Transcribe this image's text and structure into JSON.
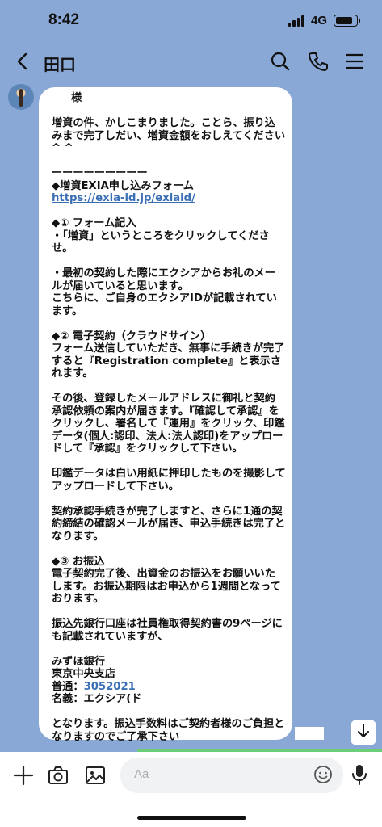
{
  "status": {
    "time": "8:42",
    "network": "4G"
  },
  "header": {
    "title": "田口"
  },
  "message": {
    "greeting": "様",
    "body_top": "増資の件、かしこまりました。ことら、振り込みまで完了しだい、増資金額をおしえてください^ ^\n\nーーーーーーーーー\n◆増資EXIA申し込みフォーム\n",
    "link": "https://exia-id.jp/exiaid/",
    "body_mid": "\n\n◆① フォーム記入\n・「増資」というところをクリックしてくださせ。\n\n・最初の契約した際にエクシアからお礼のメールが届いていると思います。\nこちらに、ご自身のエクシアIDが記載されています。\n\n◆② 電子契約（クラウドサイン）\nフォーム送信していただき、無事に手続きが完了すると『Registration complete』と表示されます。\n\nその後、登録したメールアドレスに御礼と契約承認依頼の案内が届きます。『確認して承認』をクリックし、署名して『運用』をクリック、印鑑データ(個人:認印、法人:法人認印)をアップロードして『承認』をクリックして下さい。\n\n印鑑データは白い用紙に押印したものを撮影してアップロードして下さい。\n\n契約承認手続きが完了しますと、さらに1通の契約締結の確認メールが届き、申込手続きは完了となります。\n\n◆③ お振込\n電子契約完了後、出資金のお振込をお願いいたします。お振込期限はお申込から1週間となっております。\n\n振込先銀行口座は社員権取得契約書の9ページにも記載されていますが、\n\nみずほ銀行\n東京中央支店\n普通：",
    "account_number": "3052021",
    "body_end": "\n名義：エクシア(ド\n\nとなります。振込手数料はご契約者様のご負担となりますのでご了承下さい"
  },
  "input": {
    "placeholder": "Aa"
  },
  "icons": {
    "back": "chevron-left-icon",
    "search": "search-icon",
    "call": "phone-icon",
    "menu": "hamburger-menu-icon",
    "add": "plus-icon",
    "camera": "camera-icon",
    "image": "image-icon",
    "emoji": "emoji-icon",
    "mic": "microphone-icon",
    "scroll": "arrow-down-icon"
  },
  "colors": {
    "background": "#8aa8d6",
    "link": "#3a6fb5",
    "bubble": "#ffffff"
  }
}
